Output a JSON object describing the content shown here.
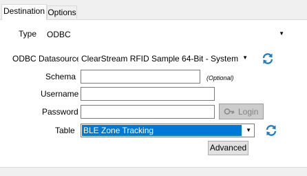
{
  "tabs": [
    {
      "label": "Destination",
      "active": true
    },
    {
      "label": "Options",
      "active": false
    }
  ],
  "type": {
    "label": "Type",
    "value": "ODBC"
  },
  "datasource": {
    "label": "ODBC Datasource",
    "value": "ClearStream RFID Sample 64-Bit - System"
  },
  "schema": {
    "label": "Schema",
    "value": "",
    "hint": "(Optional)"
  },
  "username": {
    "label": "Username",
    "value": ""
  },
  "password": {
    "label": "Password",
    "value": ""
  },
  "login_button": {
    "label": "Login",
    "enabled": false
  },
  "table": {
    "label": "Table",
    "value": "BLE Zone Tracking"
  },
  "advanced_button": {
    "label": "Advanced"
  },
  "colors": {
    "accent_selection": "#0078d7",
    "refresh_icon": "#1e7bc4"
  },
  "icons": [
    "refresh-icon",
    "key-icon",
    "chevron-down-icon"
  ]
}
